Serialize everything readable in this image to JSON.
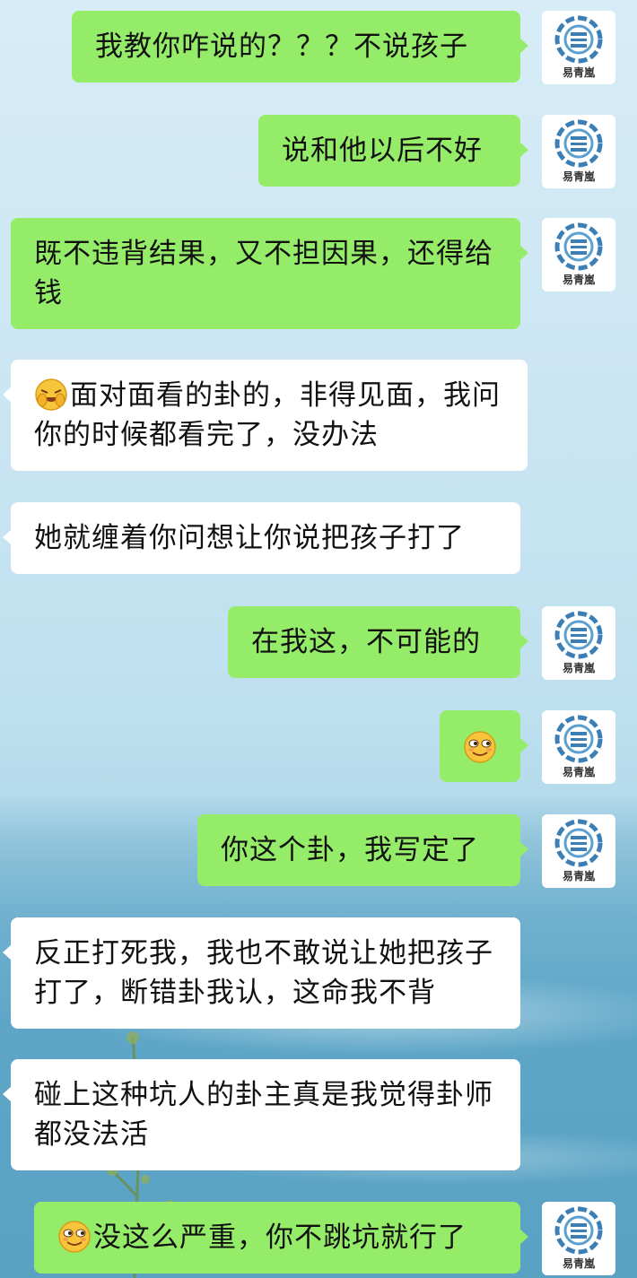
{
  "self_avatar": {
    "name": "易青嵐"
  },
  "messages": [
    {
      "side": "me",
      "text": "我教你咋说的？？？不说孩子"
    },
    {
      "side": "me",
      "text": "说和他以后不好"
    },
    {
      "side": "me",
      "text": "既不违背结果，又不担因果，还得给钱"
    },
    {
      "side": "other",
      "emoji": "facepalm-laugh-emoji",
      "text": "面对面看的卦的，非得见面，我问你的时候都看完了，没办法"
    },
    {
      "side": "other",
      "text": "她就缠着你问想让你说把孩子打了"
    },
    {
      "side": "me",
      "text": "在我这，不可能的"
    },
    {
      "side": "me",
      "emoji": "smug-smile-emoji",
      "text": ""
    },
    {
      "side": "me",
      "text": "你这个卦，我写定了"
    },
    {
      "side": "other",
      "text": "反正打死我，我也不敢说让她把孩子打了，断错卦我认，这命我不背"
    },
    {
      "side": "other",
      "text": "碰上这种坑人的卦主真是我觉得卦师都没法活"
    },
    {
      "side": "me",
      "emoji": "smug-smile-emoji",
      "text": "没这么严重，你不跳坑就行了"
    }
  ]
}
